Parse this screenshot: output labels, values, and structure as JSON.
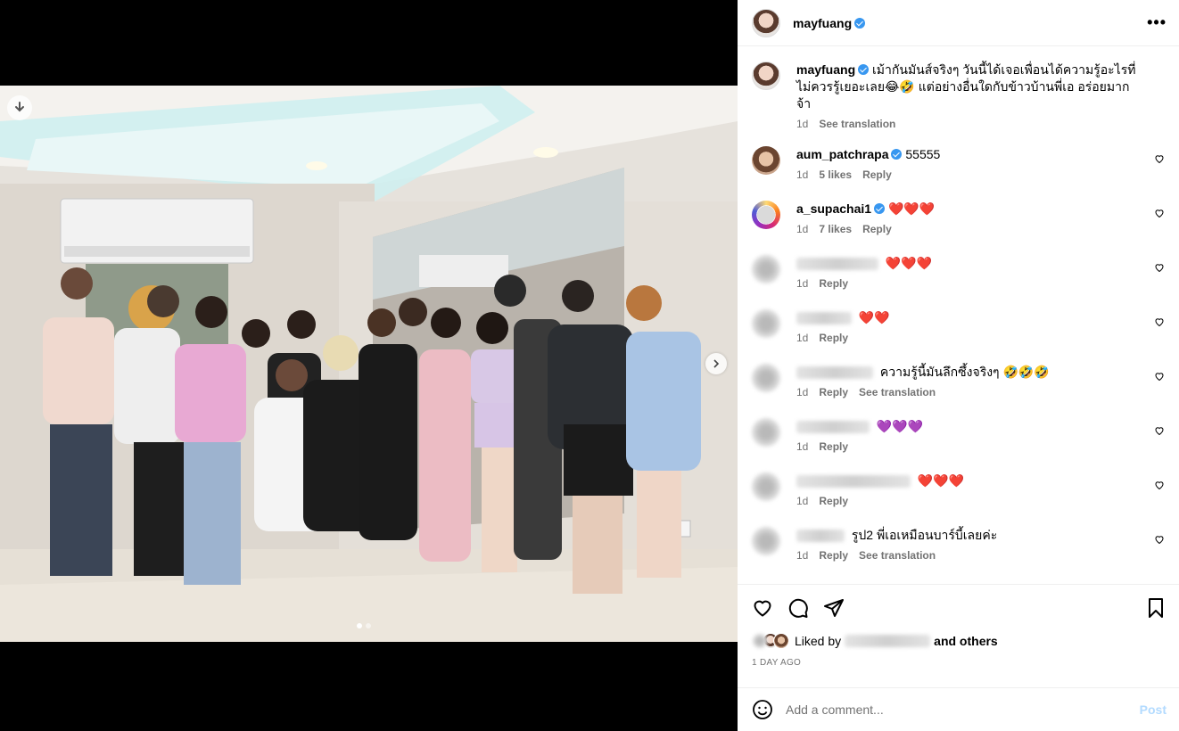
{
  "post": {
    "author": "mayfuang",
    "caption": "เม้ากันมันส์จริงๆ วันนี้ได้เจอเพื่อนได้ความรู้อะไรที่ไม่ควรรู้เยอะเลย😂🤣 แต่อย่างอื่นใดกับข้าวบ้านพี่เอ อร่อยมากจ้า",
    "caption_time": "1d",
    "see_translation": "See translation",
    "more_icon": "more-options-icon"
  },
  "comments": [
    {
      "user": "aum_patchrapa",
      "verified": true,
      "text": "55555",
      "time": "1d",
      "likes": "5 likes",
      "reply": "Reply"
    },
    {
      "user": "a_supachai1",
      "verified": true,
      "text": "❤️❤️❤️",
      "time": "1d",
      "likes": "7 likes",
      "reply": "Reply"
    },
    {
      "user": "",
      "text": "❤️❤️❤️",
      "time": "1d",
      "reply": "Reply"
    },
    {
      "user": "",
      "text": "❤️❤️",
      "time": "1d",
      "reply": "Reply"
    },
    {
      "user": "",
      "text": "ความรู้นี้มันลึกซึ้งจริงๆ 🤣🤣🤣",
      "time": "1d",
      "reply": "Reply",
      "translation": "See translation"
    },
    {
      "user": "",
      "text": "💜💜💜",
      "time": "1d",
      "reply": "Reply"
    },
    {
      "user": "",
      "text": "❤️❤️❤️",
      "time": "1d",
      "reply": "Reply"
    },
    {
      "user": "",
      "text": "รูป2 พี่เอเหมือนบาร์บี้เลยค่ะ",
      "time": "1d",
      "reply": "Reply",
      "translation": "See translation"
    }
  ],
  "likes": {
    "prefix": "Liked by",
    "suffix": "and others"
  },
  "date": "1 DAY AGO",
  "add_comment": {
    "placeholder": "Add a comment...",
    "post_label": "Post"
  },
  "carousel": {
    "count": 2,
    "active": 1
  },
  "colors": {
    "verified": "#3897f0",
    "post_disabled": "#b3dbff",
    "meta": "#737373"
  }
}
